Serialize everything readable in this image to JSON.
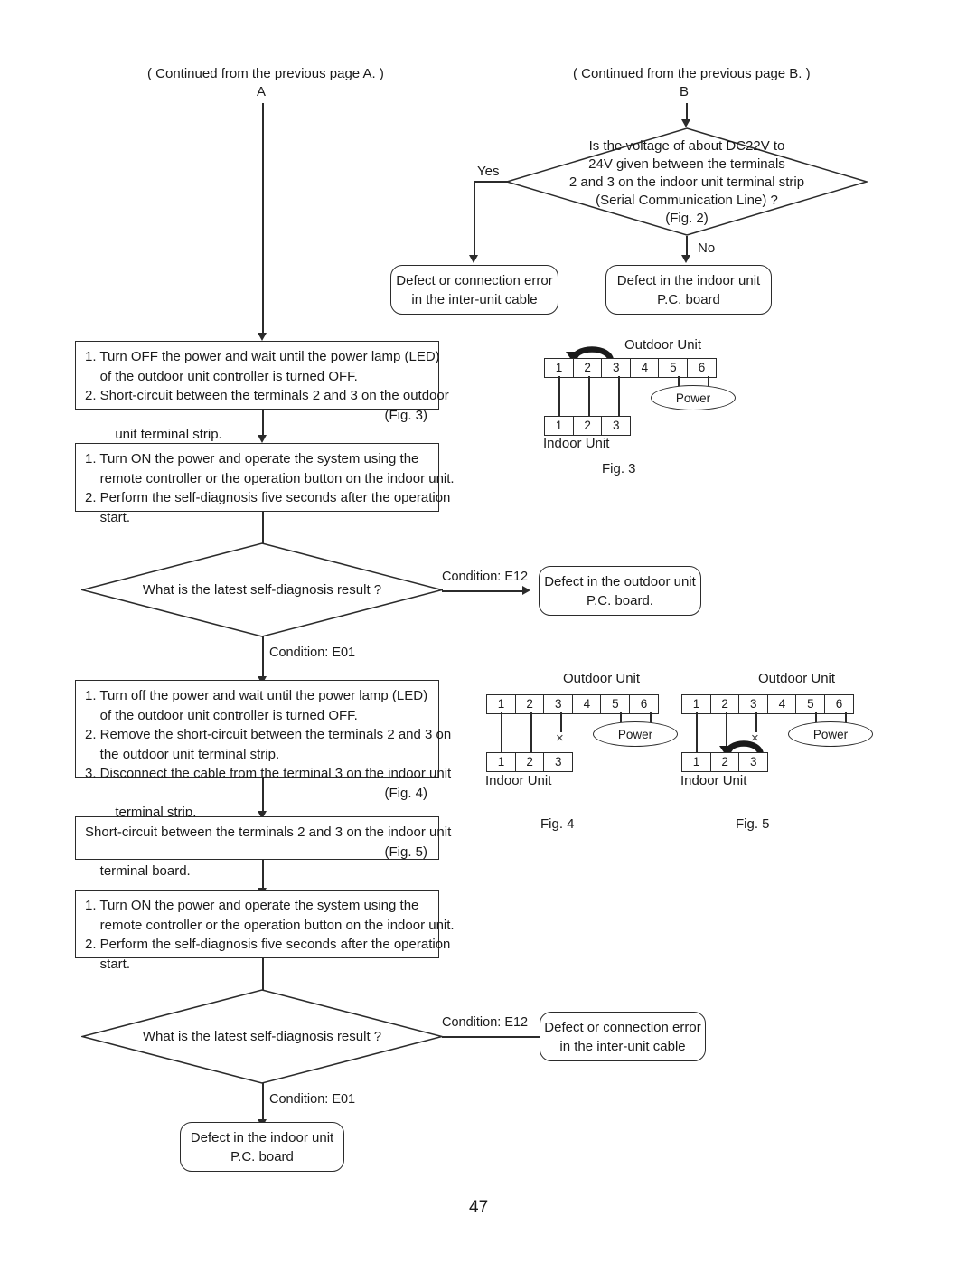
{
  "page": {
    "number": "47"
  },
  "headers": {
    "left": "( Continued from the previous page A. )",
    "left_tag": "A",
    "right": "( Continued from the previous page B. )",
    "right_tag": "B"
  },
  "decision_voltage": {
    "lines": [
      "Is the voltage of about DC22V to",
      "24V given between the terminals",
      "2 and 3 on the indoor unit terminal strip",
      "(Serial Communication Line) ?",
      "(Fig. 2)"
    ],
    "yes_label": "Yes",
    "no_label": "No"
  },
  "result_interunit_cable_top": {
    "lines": [
      "Defect or connection error",
      "in the inter-unit cable"
    ]
  },
  "result_indoor_pcb_top": {
    "lines": [
      "Defect in the indoor unit",
      "P.C. board"
    ]
  },
  "proc_1": {
    "lines": [
      "1. Turn OFF the power and wait until the power lamp (LED)",
      "    of the outdoor unit controller is turned OFF.",
      "2. Short-circuit between the terminals 2 and 3 on the outdoor",
      "    unit terminal strip."
    ],
    "fig_ref": "(Fig. 3)"
  },
  "proc_2": {
    "lines": [
      "1. Turn ON the power and operate the system using the",
      "    remote controller or the operation button on the indoor unit.",
      "2. Perform the self-diagnosis five seconds after the operation",
      "    start."
    ]
  },
  "decision_selfdiag_1": {
    "text": "What is the latest self-diagnosis result ?",
    "branch_right_label": "Condition: E12",
    "branch_down_label": "Condition: E01"
  },
  "result_outdoor_pcb": {
    "lines": [
      "Defect in the outdoor unit",
      "P.C. board."
    ]
  },
  "proc_3": {
    "lines": [
      "1. Turn off the power and wait until the power lamp (LED)",
      "    of the outdoor unit controller is turned OFF.",
      "2. Remove the short-circuit between the terminals 2 and 3 on",
      "    the outdoor unit terminal strip.",
      "3. Disconnect the cable from the terminal 3 on the indoor unit",
      "    terminal strip."
    ],
    "fig_ref": "(Fig. 4)"
  },
  "proc_4": {
    "lines": [
      "Short-circuit between the terminals 2 and 3 on the indoor unit",
      "terminal board."
    ],
    "fig_ref": "(Fig. 5)"
  },
  "proc_5": {
    "lines": [
      "1. Turn ON the power and operate the system using the",
      "    remote controller or the operation button on the indoor unit.",
      "2. Perform the self-diagnosis five seconds after the operation",
      "    start."
    ]
  },
  "decision_selfdiag_2": {
    "text": "What is the latest self-diagnosis result ?",
    "branch_right_label": "Condition: E12",
    "branch_down_label": "Condition: E01"
  },
  "result_interunit_cable_bottom": {
    "lines": [
      "Defect or connection error",
      "in the inter-unit cable"
    ]
  },
  "result_indoor_pcb_bottom": {
    "lines": [
      "Defect in the indoor unit",
      "P.C. board"
    ]
  },
  "fig3": {
    "caption": "Fig. 3",
    "outdoor_label": "Outdoor Unit",
    "indoor_label": "Indoor Unit",
    "power_label": "Power",
    "outdoor_terminals": [
      "1",
      "2",
      "3",
      "4",
      "5",
      "6"
    ],
    "indoor_terminals": [
      "1",
      "2",
      "3"
    ],
    "short_arrow": "outdoor 2-3",
    "disconnect_mark": ""
  },
  "fig4": {
    "caption": "Fig. 4",
    "outdoor_label": "Outdoor Unit",
    "indoor_label": "Indoor Unit",
    "power_label": "Power",
    "outdoor_terminals": [
      "1",
      "2",
      "3",
      "4",
      "5",
      "6"
    ],
    "indoor_terminals": [
      "1",
      "2",
      "3"
    ],
    "disconnect_mark": "×"
  },
  "fig5": {
    "caption": "Fig. 5",
    "outdoor_label": "Outdoor Unit",
    "indoor_label": "Indoor Unit",
    "power_label": "Power",
    "outdoor_terminals": [
      "1",
      "2",
      "3",
      "4",
      "5",
      "6"
    ],
    "indoor_terminals": [
      "1",
      "2",
      "3"
    ],
    "disconnect_mark": "×",
    "short_arrow": "indoor 2-3"
  }
}
